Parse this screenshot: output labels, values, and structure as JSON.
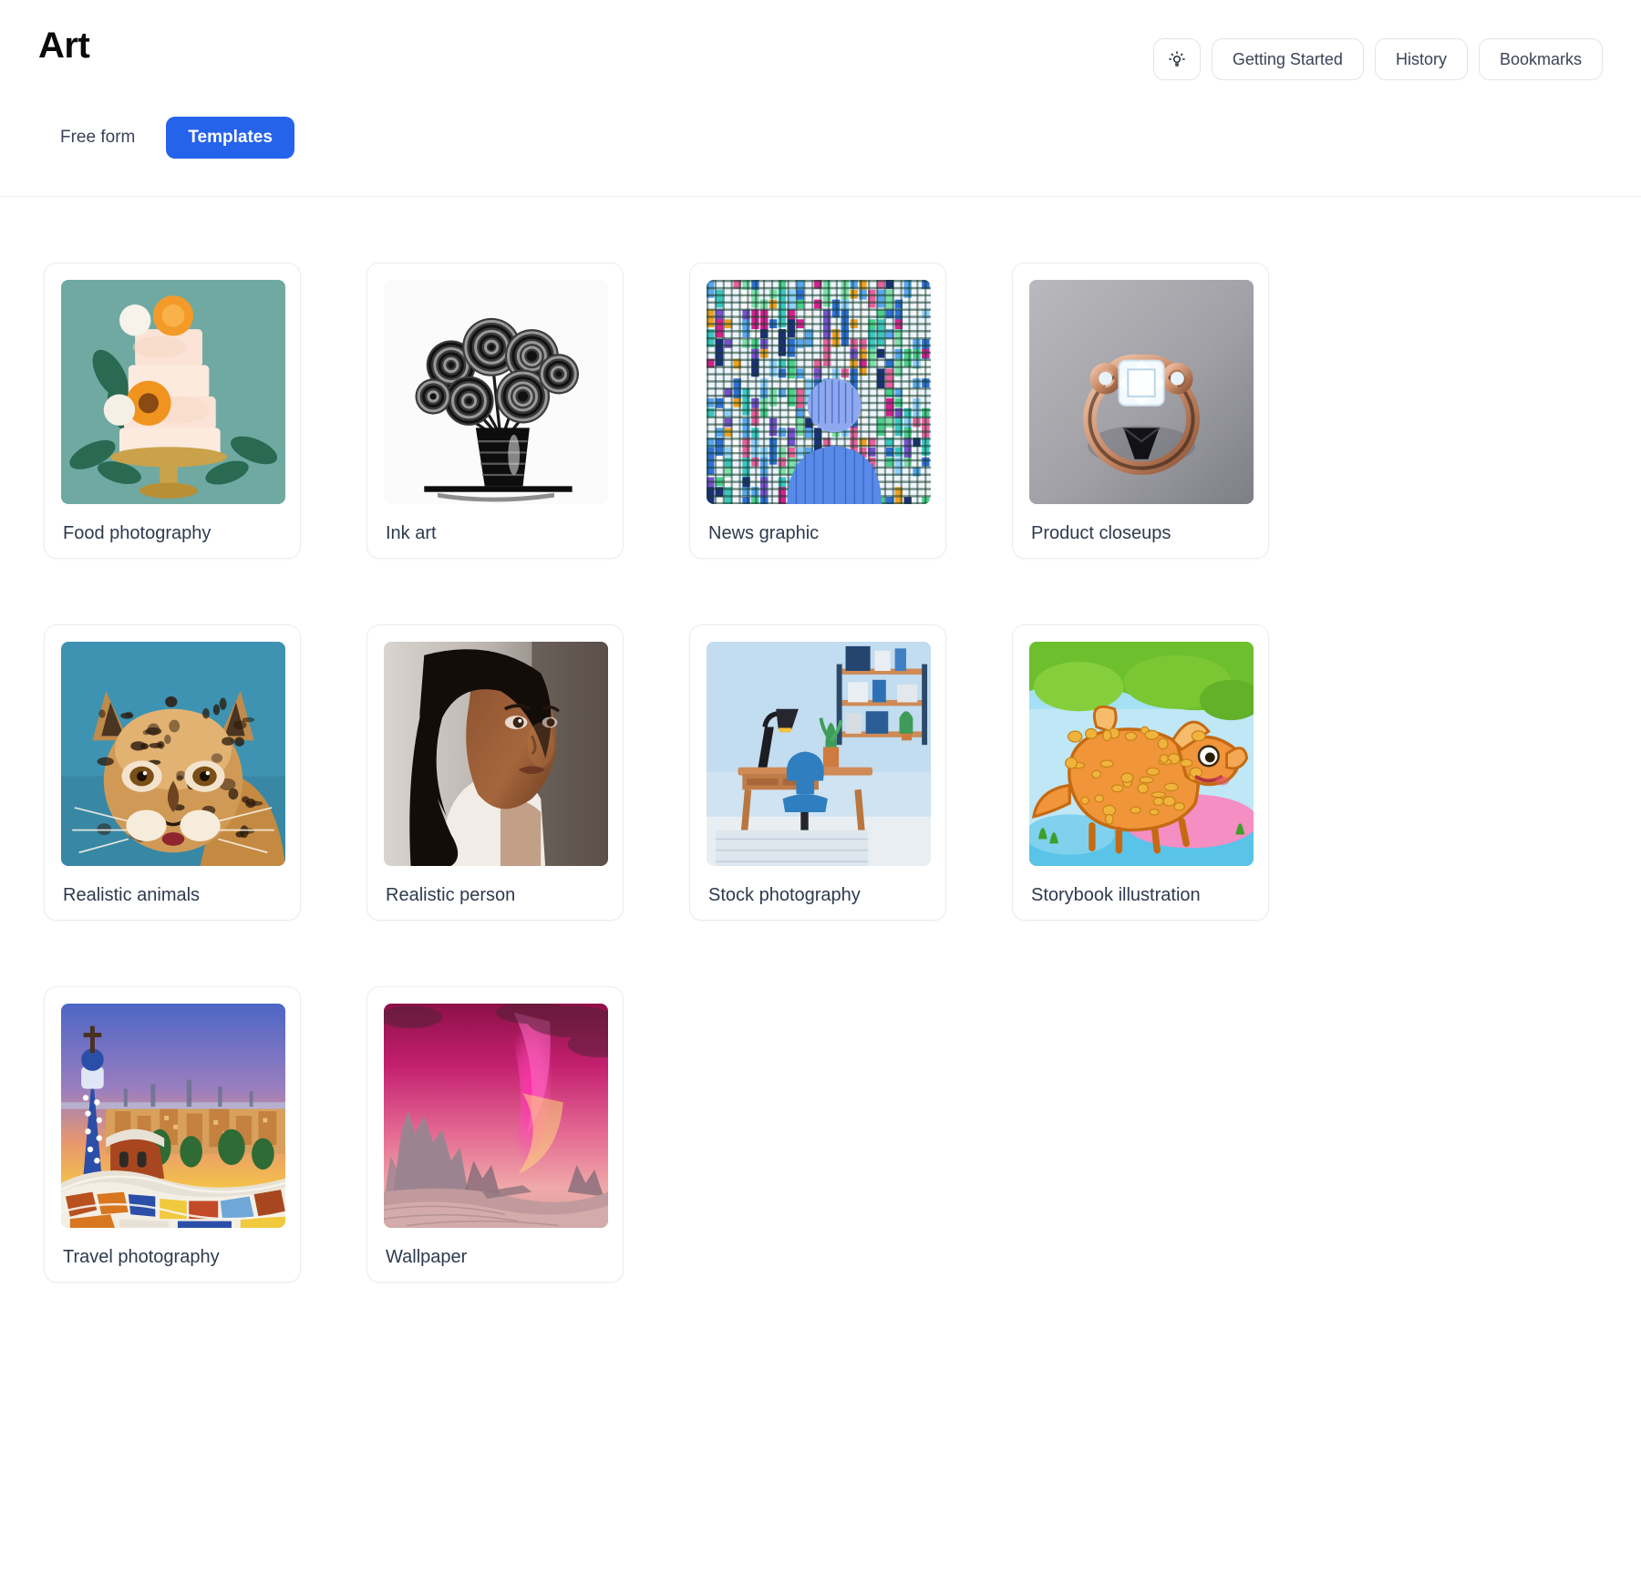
{
  "header": {
    "title": "Art",
    "actions": [
      {
        "name": "lightbulb-icon-button",
        "icon": "lightbulb-icon",
        "label": ""
      },
      {
        "name": "getting-started-button",
        "icon": "",
        "label": "Getting Started"
      },
      {
        "name": "history-button",
        "icon": "",
        "label": "History"
      },
      {
        "name": "bookmarks-button",
        "icon": "",
        "label": "Bookmarks"
      }
    ]
  },
  "tabs": [
    {
      "label": "Free form",
      "active": false
    },
    {
      "label": "Templates",
      "active": true
    }
  ],
  "colors": {
    "accent": "#2563eb",
    "text": "#2e3a4e",
    "title": "#0b0b0d",
    "border": "#ececf0",
    "background": "#ffffff"
  },
  "templates": [
    {
      "label": "Food photography",
      "art": "cake"
    },
    {
      "label": "Ink art",
      "art": "ink"
    },
    {
      "label": "News graphic",
      "art": "news"
    },
    {
      "label": "Product closeups",
      "art": "ring"
    },
    {
      "label": "Realistic animals",
      "art": "ocelot"
    },
    {
      "label": "Realistic person",
      "art": "person"
    },
    {
      "label": "Stock photography",
      "art": "desk"
    },
    {
      "label": "Storybook illustration",
      "art": "dino"
    },
    {
      "label": "Travel photography",
      "art": "travel"
    },
    {
      "label": "Wallpaper",
      "art": "aurora"
    }
  ]
}
